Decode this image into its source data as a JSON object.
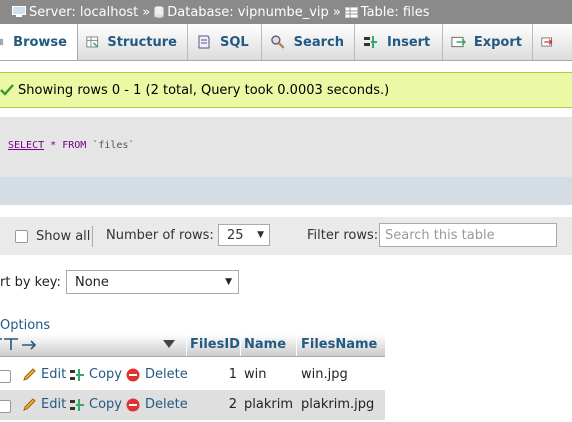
{
  "breadcrumb": {
    "server": "Server: localhost",
    "database": "Database: vipnumbe_vip",
    "table": "Table: files",
    "separator": "»"
  },
  "tabs": [
    {
      "label": "Browse",
      "icon": "browse-icon",
      "active": true
    },
    {
      "label": "Structure",
      "icon": "structure-icon",
      "active": false
    },
    {
      "label": "SQL",
      "icon": "sql-icon",
      "active": false
    },
    {
      "label": "Search",
      "icon": "search-icon",
      "active": false
    },
    {
      "label": "Insert",
      "icon": "insert-icon",
      "active": false
    },
    {
      "label": "Export",
      "icon": "export-icon",
      "active": false
    }
  ],
  "notice": {
    "text": "Showing rows 0 - 1 (2 total, Query took 0.0003 seconds.)"
  },
  "sql": {
    "select": "SELECT",
    "star_from": "* FROM",
    "table": "`files`"
  },
  "nav": {
    "show_all": "Show all",
    "number_of_rows_label": "Number of rows:",
    "number_of_rows_value": "25",
    "filter_label": "Filter rows:",
    "filter_placeholder": "Search this table"
  },
  "sort": {
    "label": "rt by key:",
    "value": "None"
  },
  "options_link": "Options",
  "table": {
    "columns": [
      "FilesID",
      "Name",
      "FilesName"
    ],
    "actions": {
      "edit": "Edit",
      "copy": "Copy",
      "delete": "Delete"
    },
    "rows": [
      {
        "id": "1",
        "name": "win",
        "filesname": "win.jpg"
      },
      {
        "id": "2",
        "name": "plakrim",
        "filesname": "plakrim.jpg"
      }
    ]
  },
  "colors": {
    "accent": "#235a81",
    "notice_bg": "#ebf8a4",
    "breadcrumb_bg": "#8a8a8a"
  }
}
